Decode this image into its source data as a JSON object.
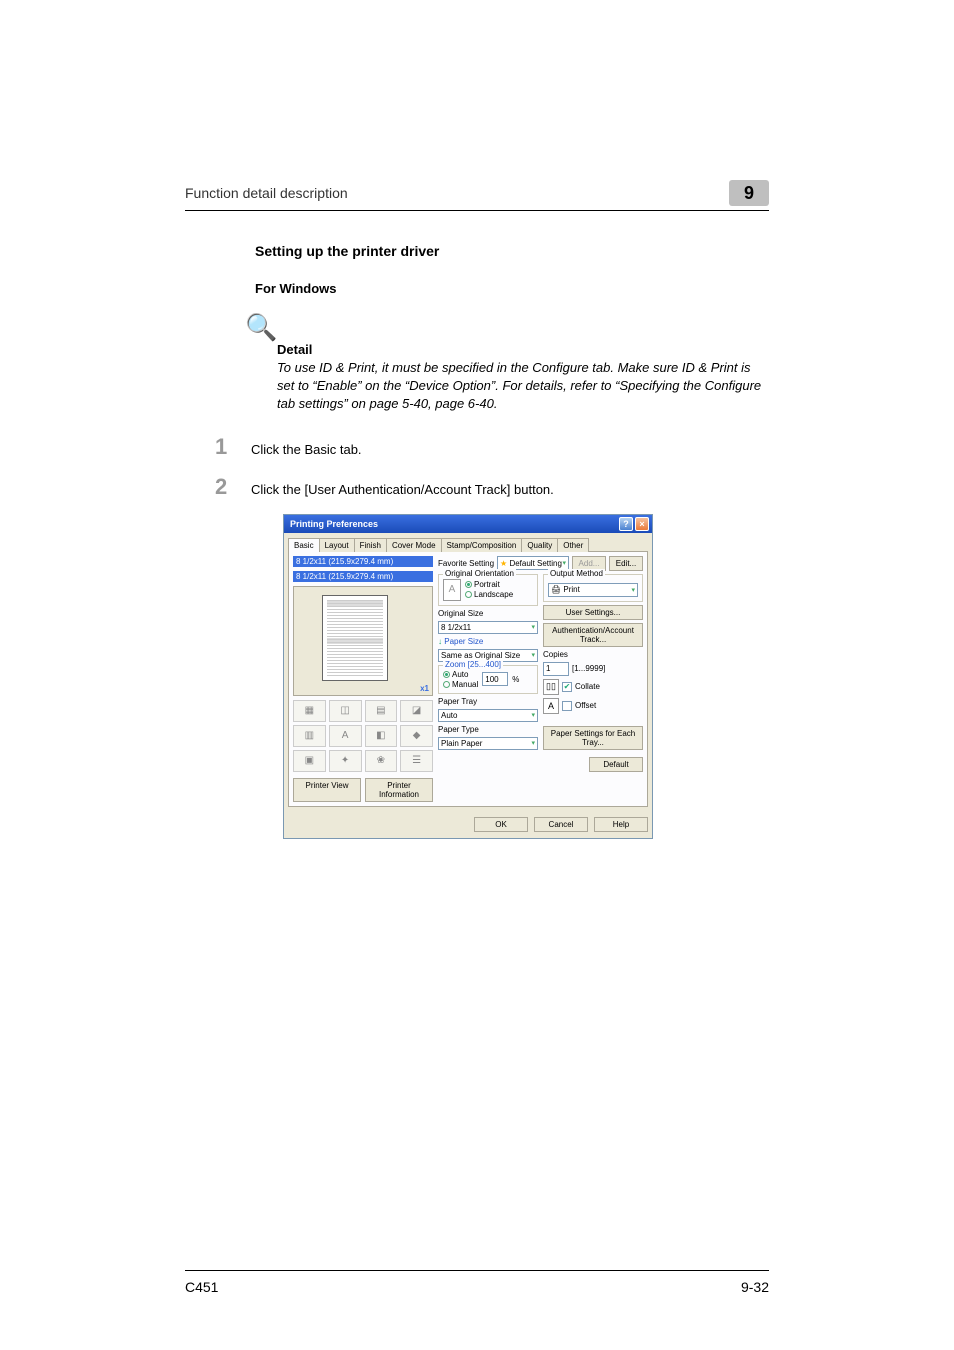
{
  "header": {
    "title": "Function detail description",
    "chapter": "9"
  },
  "section": {
    "h1": "Setting up the printer driver",
    "h2": "For Windows"
  },
  "detail": {
    "title": "Detail",
    "body": "To use ID & Print, it must be specified in the Configure tab. Make sure ID & Print is set to “Enable” on the “Device Option”. For details, refer to “Specifying the Configure tab settings” on page 5-40, page 6-40."
  },
  "steps": {
    "1": "Click the Basic tab.",
    "2": "Click the [User Authentication/Account Track] button."
  },
  "dialog": {
    "title": "Printing Preferences",
    "tabs": {
      "basic": "Basic",
      "layout": "Layout",
      "finish": "Finish",
      "cover": "Cover Mode",
      "stamp": "Stamp/Composition",
      "quality": "Quality",
      "other": "Other"
    },
    "preview": {
      "size1": "8 1/2x11 (215.9x279.4 mm)",
      "size2": "8 1/2x11 (215.9x279.4 mm)",
      "x1": "x1",
      "printerView": "Printer View",
      "printerInfo": "Printer Information"
    },
    "favorite": {
      "label": "Favorite Setting",
      "value": "Default Setting",
      "add": "Add...",
      "edit": "Edit..."
    },
    "orientation": {
      "title": "Original Orientation",
      "portrait": "Portrait",
      "landscape": "Landscape"
    },
    "originalSize": {
      "label": "Original Size",
      "value": "8 1/2x11"
    },
    "paperSize": {
      "label": "Paper Size",
      "value": "Same as Original Size"
    },
    "zoom": {
      "title": "Zoom [25...400]",
      "auto": "Auto",
      "manual": "Manual",
      "value": "100",
      "pct": "%"
    },
    "paperTray": {
      "label": "Paper Tray",
      "value": "Auto"
    },
    "paperType": {
      "label": "Paper Type",
      "value": "Plain Paper"
    },
    "outputMethod": {
      "title": "Output Method",
      "value": "Print"
    },
    "userSettings": "User Settings...",
    "authTrack": "Authentication/Account Track...",
    "copies": {
      "label": "Copies",
      "value": "1",
      "range": "[1...9999]"
    },
    "collate": "Collate",
    "offset": "Offset",
    "paperPerTray": "Paper Settings for Each Tray...",
    "default": "Default",
    "buttons": {
      "ok": "OK",
      "cancel": "Cancel",
      "help": "Help"
    }
  },
  "footer": {
    "left": "C451",
    "right": "9-32"
  }
}
